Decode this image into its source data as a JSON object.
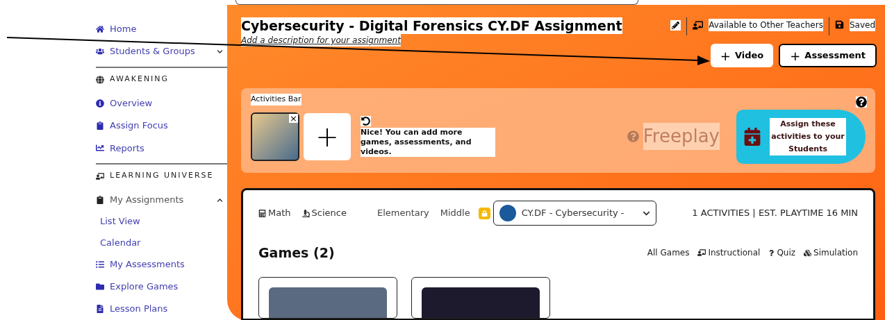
{
  "sidebar": {
    "items": [
      {
        "kind": "link",
        "label": "Home"
      },
      {
        "kind": "group",
        "label": "Students & Groups",
        "expanded": false
      },
      {
        "kind": "divider"
      },
      {
        "kind": "heading",
        "label": "AWAKENING"
      },
      {
        "kind": "link",
        "label": "Overview"
      },
      {
        "kind": "link",
        "label": "Assign Focus"
      },
      {
        "kind": "link",
        "label": "Reports"
      },
      {
        "kind": "divider"
      },
      {
        "kind": "heading",
        "label": "LEARNING UNIVERSE"
      },
      {
        "kind": "group",
        "label": "My Assignments",
        "expanded": true
      },
      {
        "kind": "sub",
        "label": "List View"
      },
      {
        "kind": "sub",
        "label": "Calendar"
      },
      {
        "kind": "link",
        "label": "My Assessments"
      },
      {
        "kind": "link",
        "label": "Explore Games"
      },
      {
        "kind": "link",
        "label": "Lesson Plans"
      }
    ]
  },
  "header": {
    "title": "Cybersecurity - Digital Forensics CY.DF Assignment",
    "description_placeholder": "Add a description for your assignment",
    "sharing": "Available to Other Teachers",
    "save_status": "Saved",
    "buttons": [
      {
        "icon": "+",
        "label": "Video"
      },
      {
        "icon": "+",
        "label": "Assessment"
      }
    ]
  },
  "activities_bar": {
    "title": "Activities Bar",
    "add_symbol": "+",
    "remove_symbol": "×",
    "hint": "Nice! You can add more games, assessments, and videos.",
    "freeplay": "Freeplay",
    "assign_button": "Assign these activities to your Students"
  },
  "filters": {
    "subjects": [
      "Math",
      "Science"
    ],
    "levels": [
      "Elementary",
      "Middle"
    ],
    "course": "CY.DF - Cybersecurity -",
    "summary": "1 ACTIVITIES | EST. PLAYTIME 16 MIN"
  },
  "games": {
    "title": "Games (2)",
    "types": [
      "All Games",
      "Instructional",
      "Quiz",
      "Simulation"
    ]
  }
}
